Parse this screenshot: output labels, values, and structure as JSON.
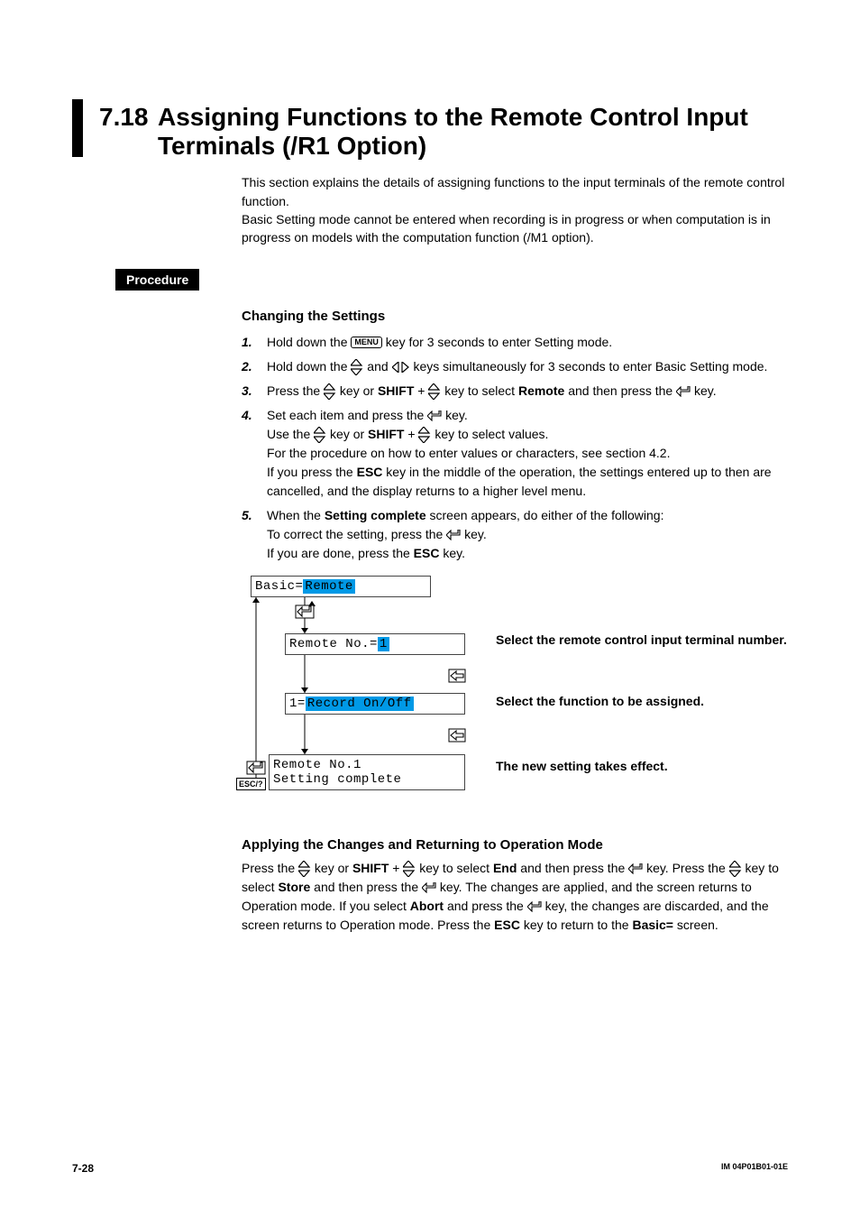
{
  "section_number": "7.18",
  "section_title": "Assigning Functions to the Remote Control Input Terminals (/R1 Option)",
  "intro": "This section explains the details of assigning functions to the input terminals of the remote control function.\nBasic Setting mode cannot be entered when recording is in progress or when computation is in progress on models with the computation function (/M1 option).",
  "procedure_label": "Procedure",
  "changing_heading": "Changing the Settings",
  "steps": {
    "s1": {
      "num": "1.",
      "pre": "Hold down the ",
      "key": "MENU",
      "post": " key for 3 seconds to enter Setting mode."
    },
    "s2": {
      "num": "2.",
      "pre": "Hold down the ",
      "mid": " and ",
      "post": " keys simultaneously for 3 seconds to enter Basic Setting mode."
    },
    "s3": {
      "num": "3.",
      "pre": "Press the ",
      "mid1": " key or ",
      "shift": "SHIFT",
      "plus": " + ",
      "mid2": " key to select ",
      "remote": "Remote",
      "mid3": " and then press the ",
      "post": " key."
    },
    "s4": {
      "num": "4.",
      "l1a": "Set each item and press the ",
      "l1b": " key.",
      "l2a": "Use the ",
      "l2b": " key or ",
      "shift": "SHIFT",
      "plus": " + ",
      "l2c": " key to select values.",
      "l3": "For the procedure on how to enter values or characters, see section 4.2.",
      "l4a": "If you press the ",
      "esc": "ESC",
      "l4b": " key in the middle of the operation, the settings entered up to then are cancelled, and the display returns to a higher level menu."
    },
    "s5": {
      "num": "5.",
      "l1a": "When the ",
      "sc": "Setting complete",
      "l1b": " screen appears, do either of the following:",
      "l2a": "To correct the setting, press the ",
      "l2b": " key.",
      "l3a": "If you are done, press the ",
      "esc": "ESC",
      "l3b": " key."
    }
  },
  "diagram": {
    "lcd1_prefix": "Basic=",
    "lcd1_hl": "Remote",
    "lcd2_prefix": "Remote No.=",
    "lcd2_hl": "1",
    "lcd3_prefix": "1=",
    "lcd3_hl": "Record On/Off",
    "lcd4_l1": "Remote No.1",
    "lcd4_l2": "Setting complete",
    "esc_label": "ESC/?",
    "label1": "Select the remote control input terminal number.",
    "label2": "Select the function to be assigned.",
    "label3": "The new setting takes effect."
  },
  "applying": {
    "heading": "Applying the Changes and Returning to Operation Mode",
    "t1": "Press the ",
    "t2": " key or ",
    "shift": "SHIFT",
    "plus": " + ",
    "t3": " key to select ",
    "end": "End",
    "t4": " and then press the ",
    "t5": " key. Press the ",
    "t6": " key to select ",
    "store": "Store",
    "t7": " and then press the ",
    "t8": " key. The changes are applied, and the screen returns to Operation mode. If you select ",
    "abort": "Abort",
    "t9": " and press the ",
    "t10": " key, the changes are discarded, and the screen returns to Operation mode. Press the ",
    "esc": "ESC",
    "t11": " key to return to the ",
    "basic": "Basic=",
    "t12": " screen."
  },
  "footer": {
    "page": "7-28",
    "doc": "IM 04P01B01-01E"
  }
}
